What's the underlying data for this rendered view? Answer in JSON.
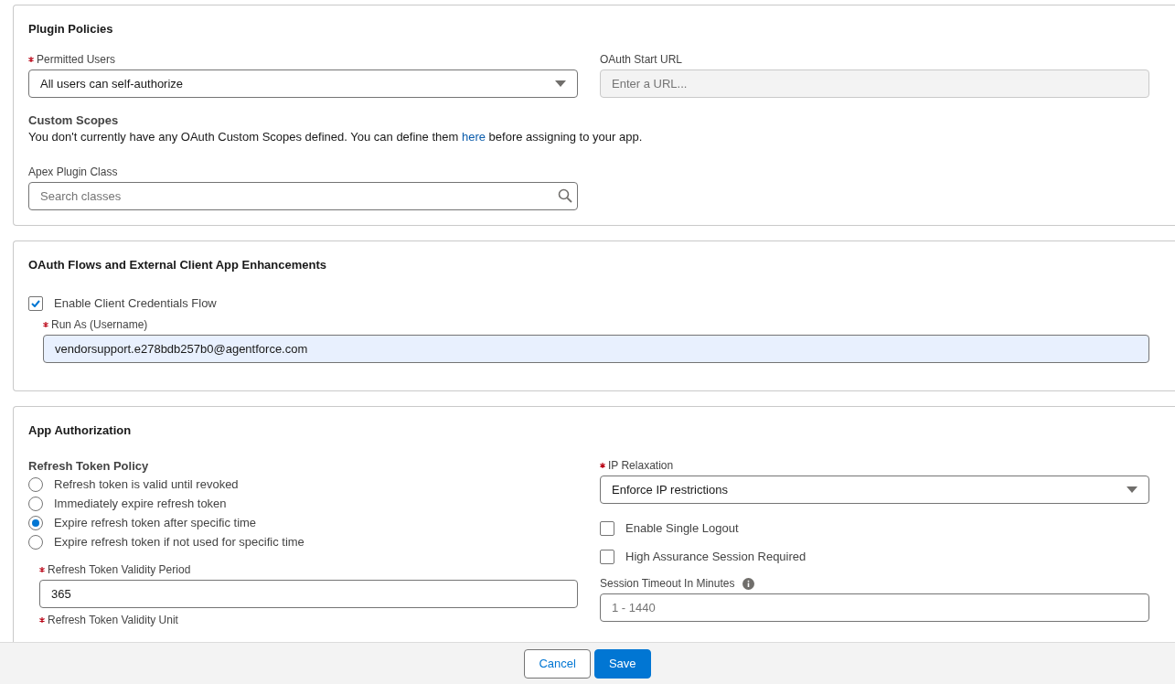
{
  "plugin_policies": {
    "title": "Plugin Policies",
    "permitted_users": {
      "label": "Permitted Users",
      "required": true,
      "value": "All users can self-authorize"
    },
    "oauth_start_url": {
      "label": "OAuth Start URL",
      "placeholder": "Enter a URL...",
      "disabled": true
    },
    "custom_scopes": {
      "title": "Custom Scopes",
      "text_before": "You don't currently have any OAuth Custom Scopes defined. You can define them ",
      "link": "here",
      "text_after": " before assigning to your app."
    },
    "apex_plugin_class": {
      "label": "Apex Plugin Class",
      "placeholder": "Search classes"
    }
  },
  "oauth_flows": {
    "title": "OAuth Flows and External Client App Enhancements",
    "client_credentials": {
      "label": "Enable Client Credentials Flow",
      "checked": true
    },
    "run_as": {
      "label": "Run As (Username)",
      "required": true,
      "value": "vendorsupport.e278bdb257b0@agentforce.com"
    }
  },
  "app_authorization": {
    "title": "App Authorization",
    "refresh_token_policy": {
      "label": "Refresh Token Policy",
      "options": [
        {
          "label": "Refresh token is valid until revoked",
          "selected": false
        },
        {
          "label": "Immediately expire refresh token",
          "selected": false
        },
        {
          "label": "Expire refresh token after specific time",
          "selected": true
        },
        {
          "label": "Expire refresh token if not used for specific time",
          "selected": false
        }
      ]
    },
    "validity_period": {
      "label": "Refresh Token Validity Period",
      "required": true,
      "value": "365"
    },
    "validity_unit": {
      "label": "Refresh Token Validity Unit",
      "required": true
    },
    "ip_relaxation": {
      "label": "IP Relaxation",
      "required": true,
      "value": "Enforce IP restrictions"
    },
    "checkboxes": [
      {
        "label": "Enable Single Logout",
        "checked": false
      },
      {
        "label": "High Assurance Session Required",
        "checked": false
      }
    ],
    "session_timeout": {
      "label": "Session Timeout In Minutes",
      "placeholder": "1 - 1440"
    }
  },
  "footer": {
    "buttons": [
      {
        "label": "Cancel",
        "kind": "neutral"
      },
      {
        "label": "Save",
        "kind": "brand"
      }
    ]
  }
}
